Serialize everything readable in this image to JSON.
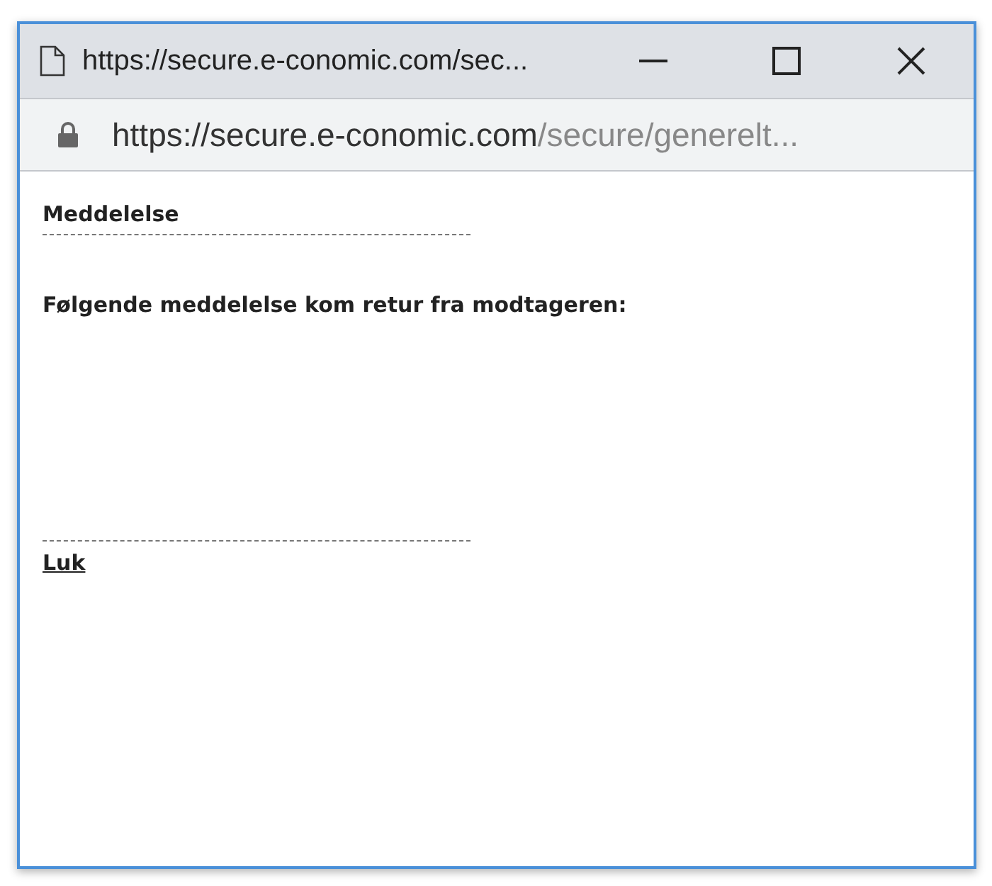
{
  "window": {
    "title": "https://secure.e-conomic.com/sec..."
  },
  "address_bar": {
    "host": "https://secure.e-conomic.com",
    "path": "/secure/generelt..."
  },
  "content": {
    "heading": "Meddelelse",
    "message": "Følgende meddelelse kom retur fra modtageren:",
    "close_link": "Luk"
  }
}
